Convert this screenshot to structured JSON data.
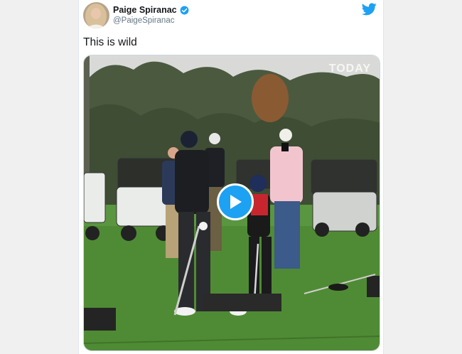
{
  "tweet": {
    "author_name": "Paige Spiranac",
    "author_handle": "@PaigeSpiranac",
    "text": "This is wild",
    "verified": true
  },
  "media": {
    "type": "video",
    "watermark": "TODAY",
    "play_icon": "play-icon"
  },
  "icons": {
    "avatar": "avatar",
    "verified": "verified-badge-icon",
    "brand": "twitter-bird-icon"
  },
  "colors": {
    "brand": "#1da1f2",
    "text": "#14171a",
    "secondary_text": "#657786",
    "grass": "#4f8b34",
    "sky": "#dcdcdc"
  }
}
